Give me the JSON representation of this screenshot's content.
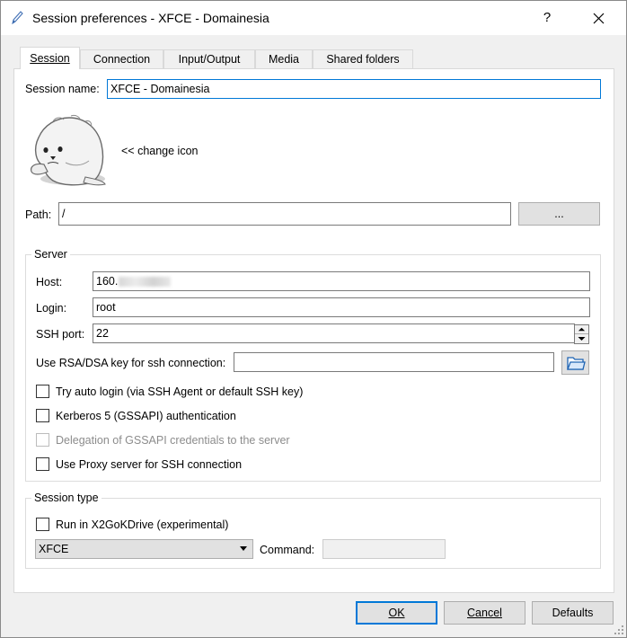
{
  "window": {
    "title": "Session preferences - XFCE - Domainesia",
    "help": "?",
    "close_icon": "close-icon"
  },
  "tabs": [
    {
      "label": "Session",
      "active": true
    },
    {
      "label": "Connection",
      "active": false
    },
    {
      "label": "Input/Output",
      "active": false
    },
    {
      "label": "Media",
      "active": false
    },
    {
      "label": "Shared folders",
      "active": false
    }
  ],
  "session": {
    "name_label": "Session name:",
    "name_value": "XFCE - Domainesia",
    "change_icon": "<< change icon",
    "path_label": "Path:",
    "path_value": "/",
    "path_button": "..."
  },
  "server": {
    "title": "Server",
    "host_label": "Host:",
    "host_value": "160.",
    "login_label": "Login:",
    "login_value": "root",
    "port_label": "SSH port:",
    "port_value": "22",
    "key_label": "Use RSA/DSA key for ssh connection:",
    "key_value": "",
    "checks": [
      {
        "label": "Try auto login (via SSH Agent or default SSH key)",
        "checked": false,
        "disabled": false
      },
      {
        "label": "Kerberos 5 (GSSAPI) authentication",
        "checked": false,
        "disabled": false
      },
      {
        "label": "Delegation of GSSAPI credentials to the server",
        "checked": false,
        "disabled": true
      },
      {
        "label": "Use Proxy server for SSH connection",
        "checked": false,
        "disabled": false
      }
    ]
  },
  "session_type": {
    "title": "Session type",
    "run_label": "Run in X2GoKDrive (experimental)",
    "type_value": "XFCE",
    "command_label": "Command:",
    "command_value": ""
  },
  "buttons": {
    "ok": "OK",
    "cancel": "Cancel",
    "defaults": "Defaults"
  },
  "colors": {
    "accent": "#0078d7"
  }
}
